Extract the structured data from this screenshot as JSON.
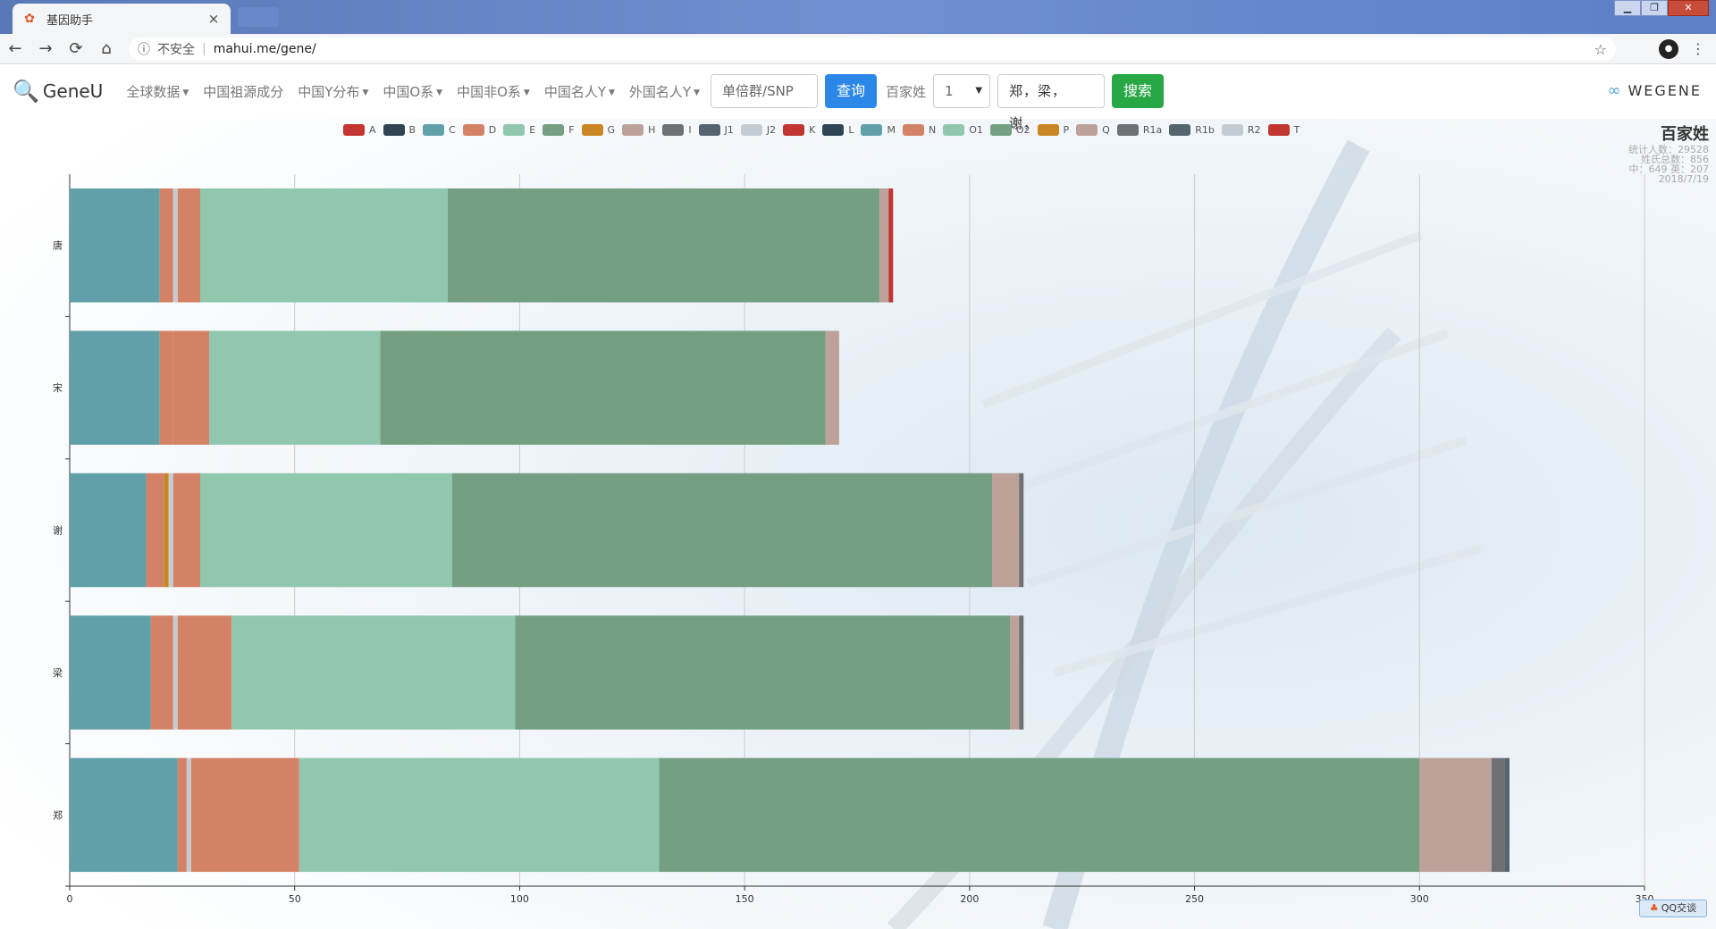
{
  "browser": {
    "tab_title": "基因助手",
    "tab_close": "×",
    "url_info_icon": "info-icon",
    "insecure_label": "不安全",
    "url_separator": "|",
    "url": "mahui.me/gene/",
    "back": "←",
    "forward": "→",
    "reload": "⟳",
    "home": "⌂",
    "star": "☆",
    "menu": "⋮",
    "window_controls": [
      "▁",
      "❐",
      "✕"
    ]
  },
  "nav": {
    "logo_text": "GeneU",
    "items": [
      {
        "label": "全球数据",
        "dropdown": true
      },
      {
        "label": "中国祖源成分",
        "dropdown": false
      },
      {
        "label": "中国Y分布",
        "dropdown": true
      },
      {
        "label": "中国O系",
        "dropdown": true
      },
      {
        "label": "中国非O系",
        "dropdown": true
      },
      {
        "label": "中国名人Y",
        "dropdown": true
      },
      {
        "label": "外国名人Y",
        "dropdown": true
      }
    ],
    "snp_placeholder": "单倍群/SNP",
    "query_label": "查询",
    "surname_label": "百家姓",
    "number_value": "1",
    "names_value": "郑，梁，谢，",
    "search_label": "搜索",
    "wegene_label": "WEGENE"
  },
  "info": {
    "title": "百家姓",
    "line1": "统计人数：29528",
    "line2": "姓氏总数：856",
    "line3": "中：649 英：207",
    "line4": "2018/7/19"
  },
  "qq_label": "QQ交谈",
  "colors": {
    "A": "#c23531",
    "B": "#2f4554",
    "C": "#61a0a8",
    "D": "#d48265",
    "E": "#91c7ae",
    "F": "#749f83",
    "G": "#ca8622",
    "H": "#bda29a",
    "I": "#6e7074",
    "J1": "#546570",
    "J2": "#c4ccd3",
    "K": "#c23531",
    "L": "#2f4554",
    "M": "#61a0a8",
    "N": "#d48265",
    "O1": "#91c7ae",
    "O2": "#749f83",
    "P": "#ca8622",
    "Q": "#bda29a",
    "R1a": "#6e7074",
    "R1b": "#546570",
    "R2": "#c4ccd3",
    "T": "#c23531"
  },
  "chart_data": {
    "type": "bar",
    "orientation": "horizontal",
    "stacked": true,
    "legend": [
      "A",
      "B",
      "C",
      "D",
      "E",
      "F",
      "G",
      "H",
      "I",
      "J1",
      "J2",
      "K",
      "L",
      "M",
      "N",
      "O1",
      "O2",
      "P",
      "Q",
      "R1a",
      "R1b",
      "R2",
      "T"
    ],
    "categories": [
      "郑",
      "梁",
      "谢",
      "宋",
      "唐"
    ],
    "x_ticks": [
      "0",
      "50",
      "100",
      "150",
      "200",
      "250",
      "300",
      "350"
    ],
    "xlim": [
      0,
      350
    ],
    "grid": true,
    "legend_position": "top",
    "series": [
      {
        "name": "C",
        "values": [
          24,
          18,
          17,
          20,
          20
        ]
      },
      {
        "name": "D",
        "values": [
          2,
          5,
          4,
          3,
          3
        ]
      },
      {
        "name": "G",
        "values": [
          0,
          0,
          1,
          0,
          0
        ]
      },
      {
        "name": "J2",
        "values": [
          1,
          1,
          1,
          0,
          1
        ]
      },
      {
        "name": "N",
        "values": [
          24,
          12,
          6,
          8,
          5
        ]
      },
      {
        "name": "O1",
        "values": [
          80,
          63,
          56,
          38,
          55
        ]
      },
      {
        "name": "O2",
        "values": [
          169,
          110,
          120,
          99,
          96
        ]
      },
      {
        "name": "Q",
        "values": [
          16,
          2,
          6,
          3,
          2
        ]
      },
      {
        "name": "R1a",
        "values": [
          3,
          1,
          1,
          0,
          0
        ]
      },
      {
        "name": "R1b",
        "values": [
          1,
          0,
          0,
          0,
          0
        ]
      },
      {
        "name": "T",
        "values": [
          0,
          0,
          0,
          0,
          1
        ]
      }
    ]
  }
}
